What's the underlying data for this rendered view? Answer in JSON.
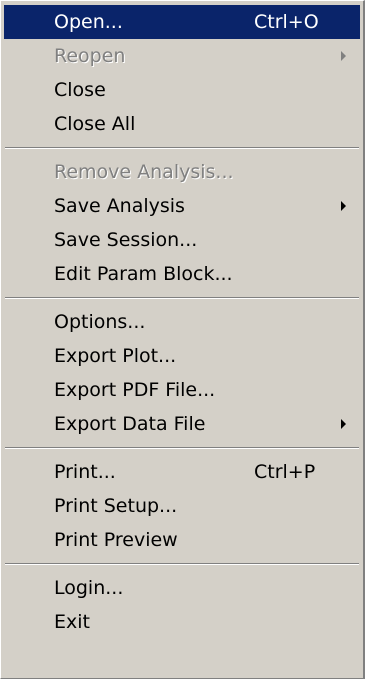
{
  "menu": {
    "items": [
      {
        "label": "Open...",
        "shortcut": "Ctrl+O"
      },
      {
        "label": "Reopen"
      },
      {
        "label": "Close"
      },
      {
        "label": "Close All"
      },
      {
        "label": "Remove Analysis..."
      },
      {
        "label": "Save Analysis"
      },
      {
        "label": "Save Session..."
      },
      {
        "label": "Edit Param Block..."
      },
      {
        "label": "Options..."
      },
      {
        "label": "Export Plot..."
      },
      {
        "label": "Export PDF File..."
      },
      {
        "label": "Export Data File"
      },
      {
        "label": "Print...",
        "shortcut": "Ctrl+P"
      },
      {
        "label": "Print Setup..."
      },
      {
        "label": "Print Preview"
      },
      {
        "label": "Login..."
      },
      {
        "label": "Exit"
      }
    ],
    "colors": {
      "menu_bg": "#d4d0c8",
      "highlight_bg": "#0a246a",
      "highlight_text": "#ffffff",
      "disabled_text": "#808080"
    },
    "icons": {
      "submenu": "submenu-arrow-icon"
    }
  }
}
